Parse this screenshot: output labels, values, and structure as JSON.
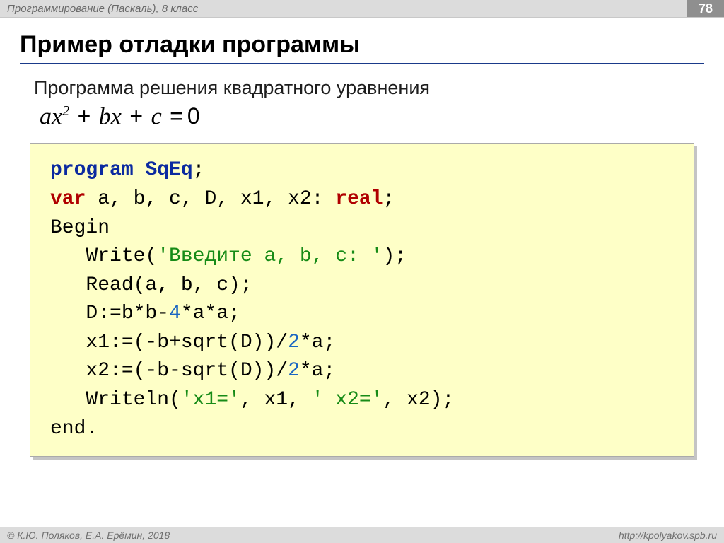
{
  "header": {
    "course": "Программирование (Паскаль), 8 класс",
    "page_number": "78"
  },
  "body": {
    "title": "Пример отладки программы",
    "subtitle": "Программа решения квадратного уравнения",
    "equation": {
      "a": "a",
      "x": "x",
      "exp": "2",
      "plus1": "+",
      "b": "b",
      "x2": "x",
      "plus2": "+",
      "c": "c",
      "eq": "=",
      "zero": "0"
    }
  },
  "code": {
    "l1_kw": "program",
    "l1_name": "SqEq",
    "l1_end": ";",
    "l2_kw": "var",
    "l2_vars": " a, b, c, D, x1, x2: ",
    "l2_type": "real",
    "l2_end": ";",
    "l3": "Begin",
    "l4_a": "   Write(",
    "l4_str": "'Введите a, b, c: '",
    "l4_b": ");",
    "l5": "   Read(a, b, c);",
    "l6_a": "   D:=b*b-",
    "l6_n": "4",
    "l6_b": "*a*a;",
    "l7_a": "   x1:=(-b+sqrt(D))/",
    "l7_n": "2",
    "l7_b": "*a;",
    "l8_a": "   x2:=(-b-sqrt(D))/",
    "l8_n": "2",
    "l8_b": "*a;",
    "l9_a": "   Writeln(",
    "l9_s1": "'x1='",
    "l9_m1": ", x1, ",
    "l9_s2": "' x2='",
    "l9_m2": ", x2);",
    "l10": "end."
  },
  "footer": {
    "left": "© К.Ю. Поляков, Е.А. Ерёмин, 2018",
    "right": "http://kpolyakov.spb.ru"
  }
}
